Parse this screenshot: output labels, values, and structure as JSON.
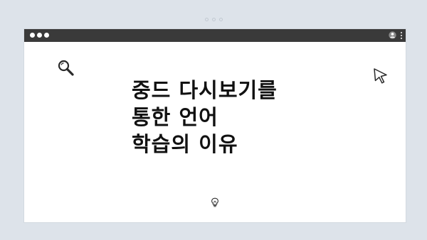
{
  "pager": {
    "dot_count": 3
  },
  "window": {
    "titlebar": {
      "window_controls": [
        "traffic-dot-1",
        "traffic-dot-2",
        "traffic-dot-3"
      ],
      "right_icons": [
        "profile-icon",
        "kebab-menu-icon"
      ]
    },
    "content": {
      "title_lines": [
        "중드 다시보기를",
        "통한 언어",
        "학습의 이유"
      ],
      "icons": [
        "search-icon",
        "cursor-arrow-icon",
        "lightbulb-icon"
      ]
    }
  },
  "colors": {
    "page_background": "#dde3ea",
    "titlebar": "#3a3a3a",
    "window_background": "#ffffff",
    "text": "#111111"
  }
}
